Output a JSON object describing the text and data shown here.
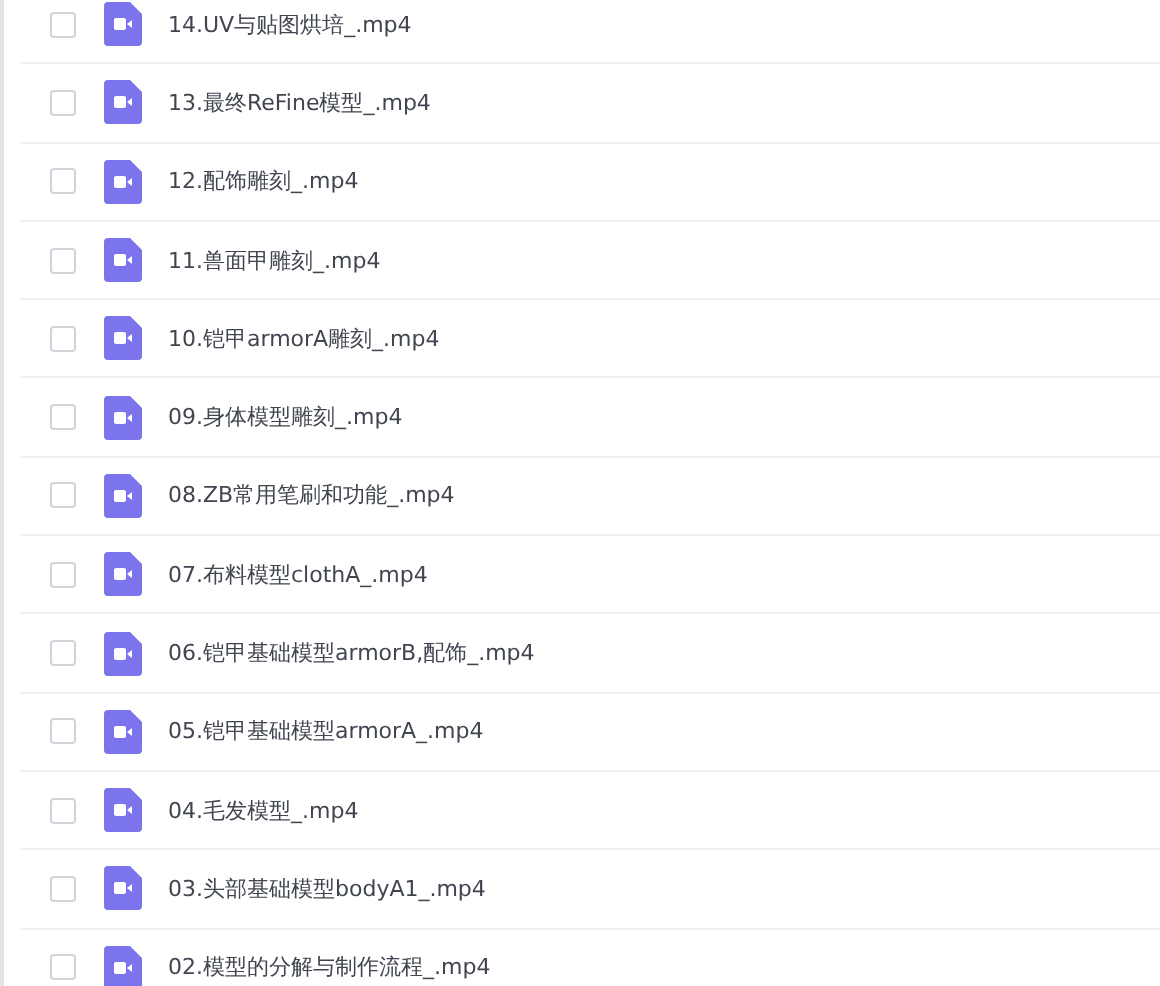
{
  "files": [
    {
      "name": "14.UV与贴图烘培_.mp4",
      "checked": false
    },
    {
      "name": "13.最终ReFine模型_.mp4",
      "checked": false
    },
    {
      "name": "12.配饰雕刻_.mp4",
      "checked": false
    },
    {
      "name": "11.兽面甲雕刻_.mp4",
      "checked": false
    },
    {
      "name": "10.铠甲armorA雕刻_.mp4",
      "checked": false
    },
    {
      "name": "09.身体模型雕刻_.mp4",
      "checked": false
    },
    {
      "name": "08.ZB常用笔刷和功能_.mp4",
      "checked": false
    },
    {
      "name": "07.布料模型clothA_.mp4",
      "checked": false
    },
    {
      "name": "06.铠甲基础模型armorB,配饰_.mp4",
      "checked": false
    },
    {
      "name": "05.铠甲基础模型armorA_.mp4",
      "checked": false
    },
    {
      "name": "04.毛发模型_.mp4",
      "checked": false
    },
    {
      "name": "03.头部基础模型bodyA1_.mp4",
      "checked": false
    },
    {
      "name": "02.模型的分解与制作流程_.mp4",
      "checked": false
    }
  ]
}
